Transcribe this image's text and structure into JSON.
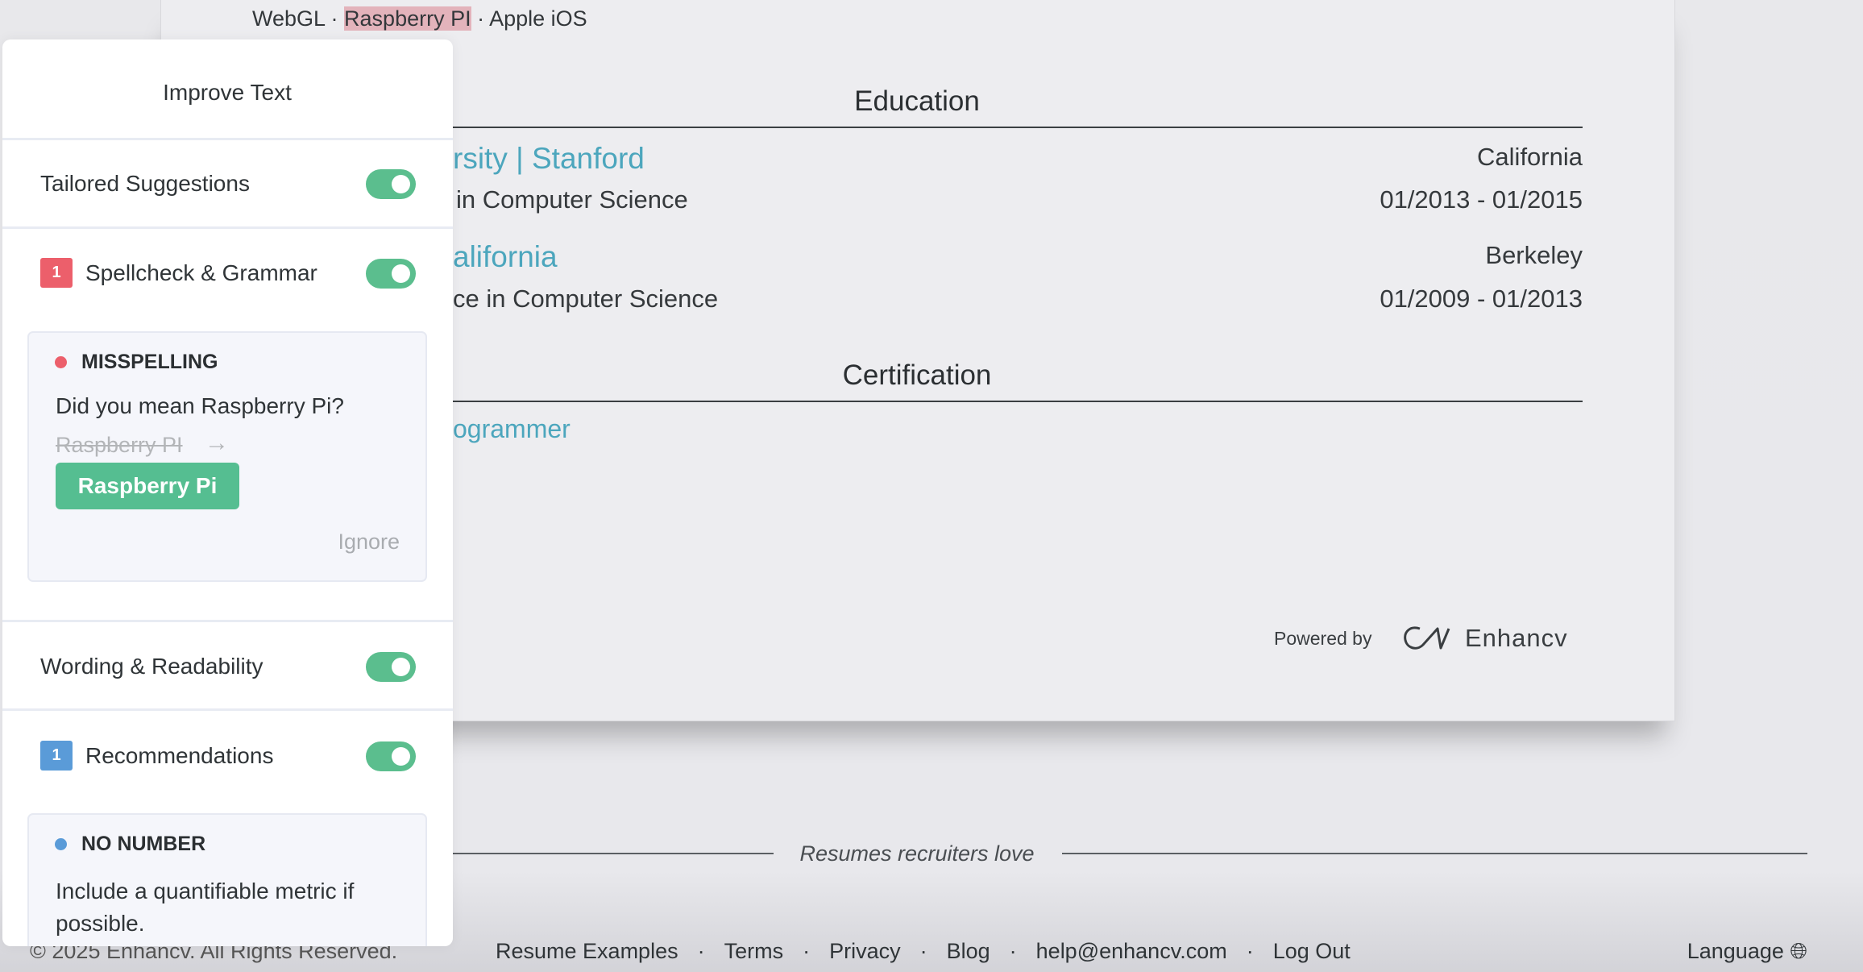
{
  "resume": {
    "skills_line": {
      "before": "WebGL · ",
      "highlight": "Raspberry PI",
      "after": " · Apple iOS"
    },
    "education_heading": "Education",
    "education": [
      {
        "school": "rsity | Stanford",
        "degree": "in Computer Science",
        "location": "California",
        "dates": "01/2013 - 01/2015"
      },
      {
        "school": "alifornia",
        "degree": "ce in Computer Science",
        "location": "Berkeley",
        "dates": "01/2009 - 01/2013"
      }
    ],
    "certification_heading": "Certification",
    "certification": "ogrammer",
    "powered_by": "Powered by",
    "brand": "Enhancv"
  },
  "panel": {
    "title": "Improve Text",
    "sections": [
      {
        "label": "Tailored Suggestions",
        "enabled": true
      },
      {
        "label": "Spellcheck & Grammar",
        "enabled": true,
        "count": "1",
        "badge_color": "#ec5f6b"
      },
      {
        "label": "Wording & Readability",
        "enabled": true
      },
      {
        "label": "Recommendations",
        "enabled": true,
        "count": "1",
        "badge_color": "#5a9bd8"
      }
    ],
    "misspelling": {
      "category": "MISSPELLING",
      "message": "Did you mean Raspberry Pi?",
      "original": "Raspberry PI",
      "suggestion": "Raspberry Pi",
      "ignore": "Ignore"
    },
    "no_number": {
      "category": "NO NUMBER",
      "message": "Include a quantifiable metric if possible."
    }
  },
  "footer": {
    "tagline": "Resumes recruiters love",
    "copyright": "© 2025 Enhancv. All Rights Reserved.",
    "links": [
      "Resume Examples",
      "Terms",
      "Privacy",
      "Blog",
      "help@enhancv.com",
      "Log Out"
    ],
    "language": "Language"
  },
  "colors": {
    "accent": "#5bbe8e",
    "link": "#4ca6bd",
    "error": "#ec5f6b",
    "info": "#5a9bd8"
  }
}
